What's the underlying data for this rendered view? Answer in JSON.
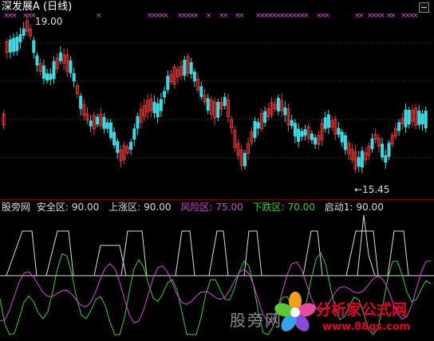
{
  "window": {
    "title": "深发展A (日线)"
  },
  "price_panel": {
    "high_label": "19.00",
    "low_label": "←15.45"
  },
  "indicator_panel": {
    "name": "股旁网",
    "items": [
      {
        "label": "安全区:",
        "value": "90.00",
        "color": "#dddddd"
      },
      {
        "label": "上涨区:",
        "value": "90.00",
        "color": "#dddddd"
      },
      {
        "label": "风险区:",
        "value": "75.00",
        "color": "#d44bd4"
      },
      {
        "label": "下跌区:",
        "value": "70.00",
        "color": "#3fc93f"
      },
      {
        "label": "启动1:",
        "value": "90.00",
        "color": "#dddddd"
      }
    ]
  },
  "watermark": {
    "text": "股旁网",
    "brand": "分析家公式网",
    "url": "www.88gs.com"
  },
  "colors": {
    "up_candle": "#e23a3a",
    "down_candle": "#3fd8e0",
    "signal_marker": "#e24ae2",
    "separator": "#6a0000",
    "safe_line": "#dddddd",
    "risk_line": "#d44bd4",
    "fall_line": "#3fc93f"
  }
}
